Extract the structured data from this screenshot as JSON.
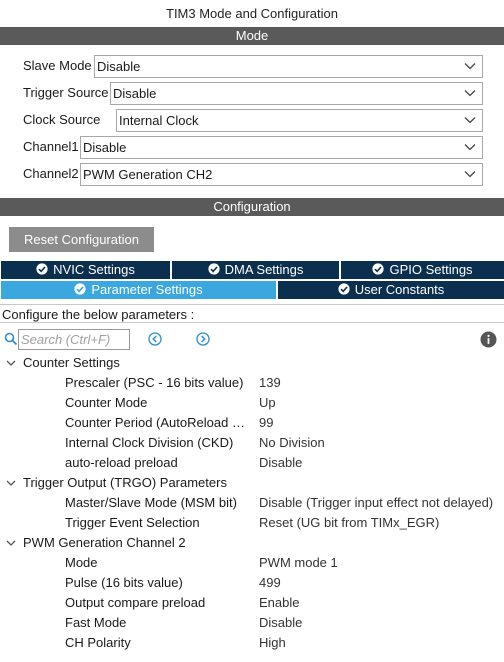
{
  "window": {
    "title": "TIM3 Mode and Configuration"
  },
  "mode_section": {
    "header": "Mode",
    "rows": [
      {
        "label": "Slave Mode",
        "value": "Disable"
      },
      {
        "label": "Trigger Source",
        "value": "Disable"
      },
      {
        "label": "Clock Source",
        "value": "Internal Clock"
      },
      {
        "label": "Channel1",
        "value": "Disable"
      },
      {
        "label": "Channel2",
        "value": "PWM Generation CH2"
      }
    ]
  },
  "config_section": {
    "header": "Configuration",
    "reset_button": "Reset Configuration",
    "tabs": [
      {
        "label": "NVIC Settings",
        "active": false
      },
      {
        "label": "DMA Settings",
        "active": false
      },
      {
        "label": "GPIO Settings",
        "active": false
      },
      {
        "label": "Parameter Settings",
        "active": true
      },
      {
        "label": "User Constants",
        "active": false
      }
    ],
    "hint": "Configure the below parameters :",
    "search_placeholder": "Search (Ctrl+F)"
  },
  "parameters": [
    {
      "group": "Counter Settings",
      "items": [
        {
          "name": "Prescaler (PSC - 16 bits value)",
          "value": "139"
        },
        {
          "name": "Counter Mode",
          "value": "Up"
        },
        {
          "name": "Counter Period (AutoReload R...",
          "value": "99"
        },
        {
          "name": "Internal Clock Division (CKD)",
          "value": "No Division"
        },
        {
          "name": "auto-reload preload",
          "value": "Disable"
        }
      ]
    },
    {
      "group": "Trigger Output (TRGO) Parameters",
      "items": [
        {
          "name": "Master/Slave Mode (MSM bit)",
          "value": "Disable (Trigger input effect not delayed)"
        },
        {
          "name": "Trigger Event Selection",
          "value": "Reset (UG bit from TIMx_EGR)"
        }
      ]
    },
    {
      "group": "PWM Generation Channel 2",
      "items": [
        {
          "name": "Mode",
          "value": "PWM mode 1"
        },
        {
          "name": "Pulse (16 bits value)",
          "value": "499"
        },
        {
          "name": "Output compare preload",
          "value": "Enable"
        },
        {
          "name": "Fast Mode",
          "value": "Disable"
        },
        {
          "name": "CH Polarity",
          "value": "High"
        }
      ]
    }
  ],
  "icons": {
    "search": "search-icon",
    "prev": "previous-match-icon",
    "next": "next-match-icon",
    "info": "info-icon",
    "tab_check": "check-circle-icon",
    "dropdown": "chevron-down-icon",
    "group_toggle": "chevron-down-icon"
  },
  "colors": {
    "section_bar": "#5a5a5a",
    "tab_dark": "#0b2f4f",
    "tab_active": "#3aa7de",
    "reset_button": "#8c8c8c",
    "nav_icons": "#2a8fd0"
  }
}
